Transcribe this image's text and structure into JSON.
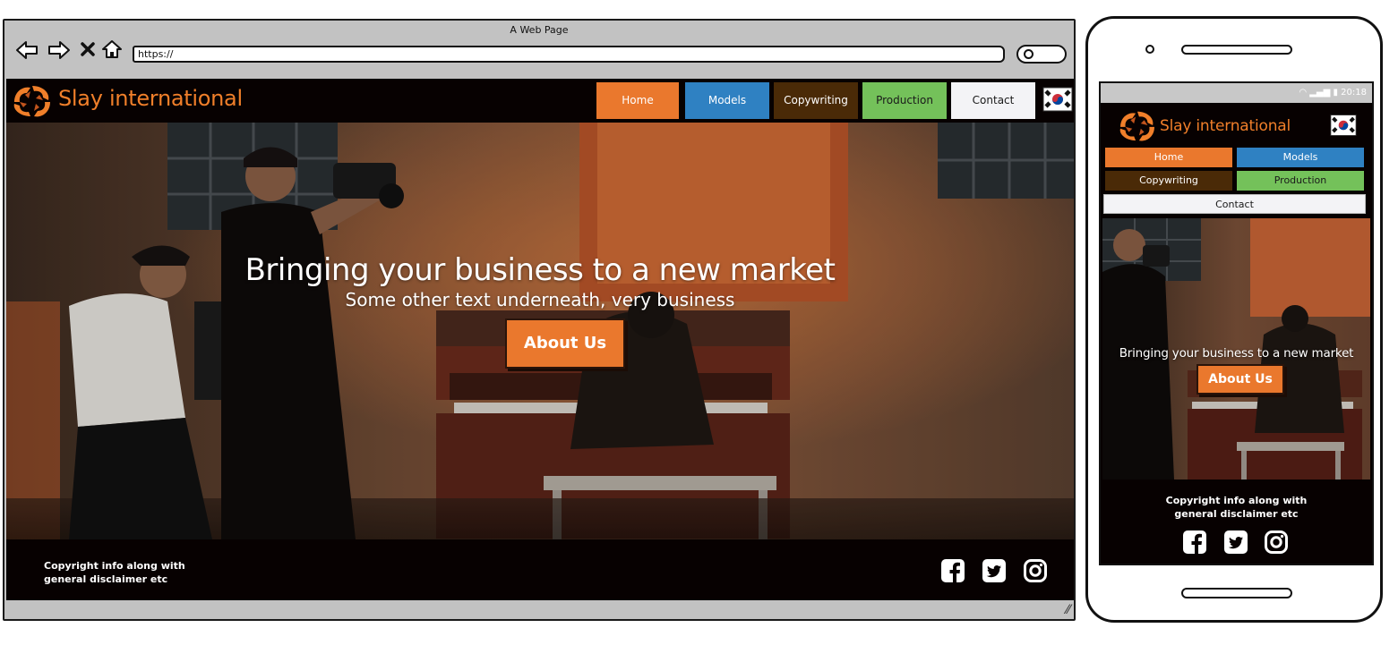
{
  "browser": {
    "title": "A Web Page",
    "url": "https://",
    "icons": [
      "back-arrow-icon",
      "forward-arrow-icon",
      "close-x-icon",
      "home-icon",
      "search-icon"
    ]
  },
  "site": {
    "brand": "Slay international",
    "nav": [
      {
        "label": "Home",
        "bg": "#ea782d",
        "color": "#ffffff"
      },
      {
        "label": "Models",
        "bg": "#2f81c2",
        "color": "#ffffff"
      },
      {
        "label": "Copywriting",
        "bg": "#4a2a07",
        "color": "#ffffff"
      },
      {
        "label": "Production",
        "bg": "#74c15a",
        "color": "#1a1a1a"
      },
      {
        "label": "Contact",
        "bg": "#f3f3f6",
        "color": "#1a1a1a"
      }
    ],
    "flag": "korean-flag-icon",
    "hero": {
      "title": "Bringing your business to a new market",
      "subtitle": "Some other text underneath, very business",
      "button": "About Us"
    },
    "footer": {
      "copy_line1": "Copyright info along with",
      "copy_line2": "general disclaimer etc",
      "social": [
        "facebook-icon",
        "twitter-icon",
        "instagram-icon"
      ]
    },
    "colors": {
      "accent": "#ea782d",
      "header_bg": "#070101",
      "brand_text": "#f07f2a"
    }
  },
  "phone": {
    "status_time": "20:18"
  }
}
